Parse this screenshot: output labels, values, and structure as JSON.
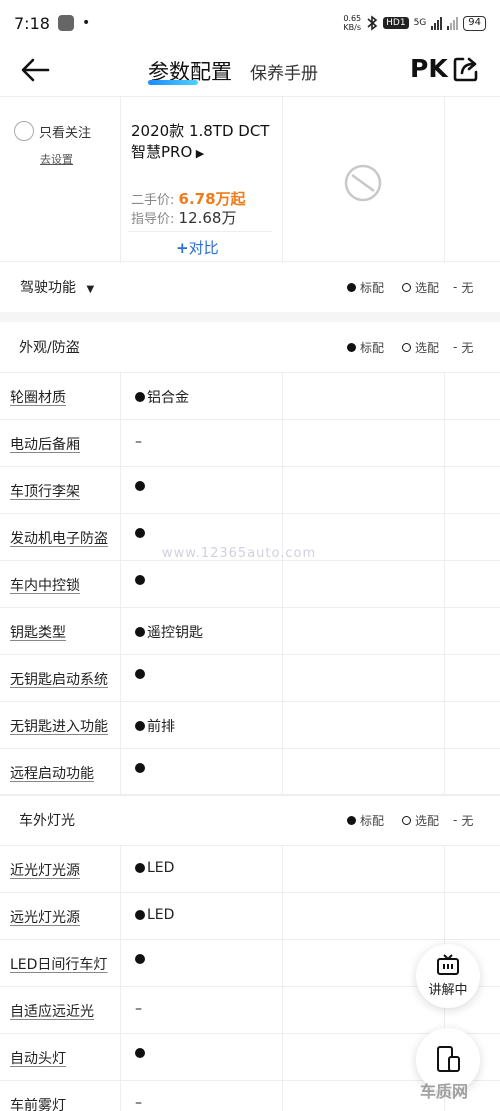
{
  "status_bar": {
    "time": "7:18",
    "dot": "•",
    "net_speed_value": "0.65",
    "net_speed_unit": "KB/s",
    "hd_badge": "HD1",
    "network": "5G",
    "battery": "94"
  },
  "header": {
    "active_tab": "参数配置",
    "other_tab": "保养手册",
    "pk_label": "PK"
  },
  "car": {
    "follow_label": "只看关注",
    "settings_link": "去设置",
    "name": "2020款 1.8TD DCT 智慧PRO",
    "used_price_label": "二手价:",
    "used_price_value": "6.78万起",
    "guide_price_label": "指导价:",
    "guide_price_value": "12.68万",
    "compare_label": "对比"
  },
  "legend": {
    "standard": "标配",
    "optional": "选配",
    "none": "无",
    "dash": "-"
  },
  "sections": {
    "driving": "驾驶功能",
    "exterior": "外观/防盗",
    "lights": "车外灯光"
  },
  "exterior_rows": [
    {
      "label": "轮圈材质",
      "value": "铝合金",
      "dot": true
    },
    {
      "label": "电动后备厢",
      "value": "–",
      "dot": false
    },
    {
      "label": "车顶行李架",
      "value": "",
      "dot": true
    },
    {
      "label": "发动机电子防盗",
      "value": "",
      "dot": true
    },
    {
      "label": "车内中控锁",
      "value": "",
      "dot": true
    },
    {
      "label": "钥匙类型",
      "value": "遥控钥匙",
      "dot": true
    },
    {
      "label": "无钥匙启动系统",
      "value": "",
      "dot": true
    },
    {
      "label": "无钥匙进入功能",
      "value": "前排",
      "dot": true
    },
    {
      "label": "远程启动功能",
      "value": "",
      "dot": true
    }
  ],
  "light_rows": [
    {
      "label": "近光灯光源",
      "value": "LED",
      "dot": true
    },
    {
      "label": "远光灯光源",
      "value": "LED",
      "dot": true
    },
    {
      "label": "LED日间行车灯",
      "value": "",
      "dot": true
    },
    {
      "label": "自适应远近光",
      "value": "–",
      "dot": false
    },
    {
      "label": "自动头灯",
      "value": "",
      "dot": true
    },
    {
      "label": "车前雾灯",
      "value": "–",
      "dot": false
    }
  ],
  "floating": {
    "explain_label": "讲解中"
  },
  "watermark": "www.12365auto.com",
  "logo_text": "车质网"
}
